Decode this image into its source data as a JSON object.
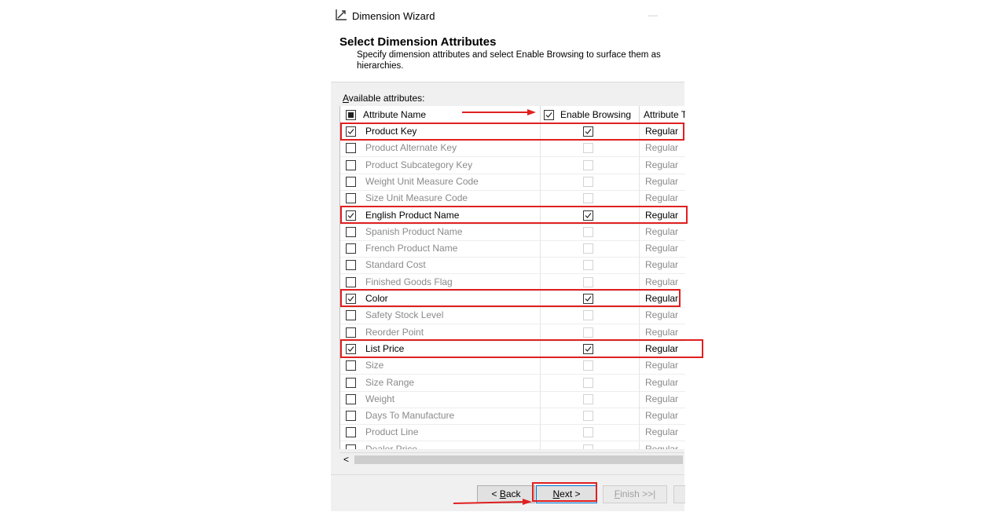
{
  "window": {
    "title": "Dimension Wizard",
    "minimize_glyph": "—",
    "icon": "dimension-wizard-icon"
  },
  "header": {
    "title": "Select Dimension Attributes",
    "description": "Specify dimension attributes and select Enable Browsing to surface them as hierarchies."
  },
  "panel": {
    "available_label_mnemonic": "A",
    "available_label_rest": "vailable attributes:"
  },
  "grid": {
    "columns": {
      "name": "Attribute Name",
      "enable": "Enable Browsing",
      "type": "Attribute T"
    },
    "header_select_all": "indeterminate",
    "header_enable_checked": true,
    "rows": [
      {
        "name": "Product Key",
        "type": "Regular",
        "checked": true,
        "enable": true
      },
      {
        "name": "Product Alternate Key",
        "type": "Regular",
        "checked": false,
        "enable": false
      },
      {
        "name": "Product Subcategory Key",
        "type": "Regular",
        "checked": false,
        "enable": false
      },
      {
        "name": "Weight Unit Measure Code",
        "type": "Regular",
        "checked": false,
        "enable": false
      },
      {
        "name": "Size Unit Measure Code",
        "type": "Regular",
        "checked": false,
        "enable": false
      },
      {
        "name": "English Product Name",
        "type": "Regular",
        "checked": true,
        "enable": true
      },
      {
        "name": "Spanish Product Name",
        "type": "Regular",
        "checked": false,
        "enable": false
      },
      {
        "name": "French Product Name",
        "type": "Regular",
        "checked": false,
        "enable": false
      },
      {
        "name": "Standard Cost",
        "type": "Regular",
        "checked": false,
        "enable": false
      },
      {
        "name": "Finished Goods Flag",
        "type": "Regular",
        "checked": false,
        "enable": false
      },
      {
        "name": "Color",
        "type": "Regular",
        "checked": true,
        "enable": true
      },
      {
        "name": "Safety Stock Level",
        "type": "Regular",
        "checked": false,
        "enable": false
      },
      {
        "name": "Reorder Point",
        "type": "Regular",
        "checked": false,
        "enable": false
      },
      {
        "name": "List Price",
        "type": "Regular",
        "checked": true,
        "enable": true
      },
      {
        "name": "Size",
        "type": "Regular",
        "checked": false,
        "enable": false
      },
      {
        "name": "Size Range",
        "type": "Regular",
        "checked": false,
        "enable": false
      },
      {
        "name": "Weight",
        "type": "Regular",
        "checked": false,
        "enable": false
      },
      {
        "name": "Days To Manufacture",
        "type": "Regular",
        "checked": false,
        "enable": false
      },
      {
        "name": "Product Line",
        "type": "Regular",
        "checked": false,
        "enable": false
      },
      {
        "name": "Dealer Price",
        "type": "Regular",
        "checked": false,
        "enable": false
      }
    ]
  },
  "scrollbar": {
    "left_arrow": "<"
  },
  "buttons": {
    "back": {
      "prefix": "< ",
      "mnemonic": "B",
      "rest": "ack"
    },
    "next": {
      "mnemonic": "N",
      "rest": "ext >"
    },
    "finish": {
      "mnemonic": "F",
      "rest": "inish >>|"
    }
  },
  "annotations": {
    "highlight_color": "#e02020",
    "arrow_color": "#e02020"
  }
}
